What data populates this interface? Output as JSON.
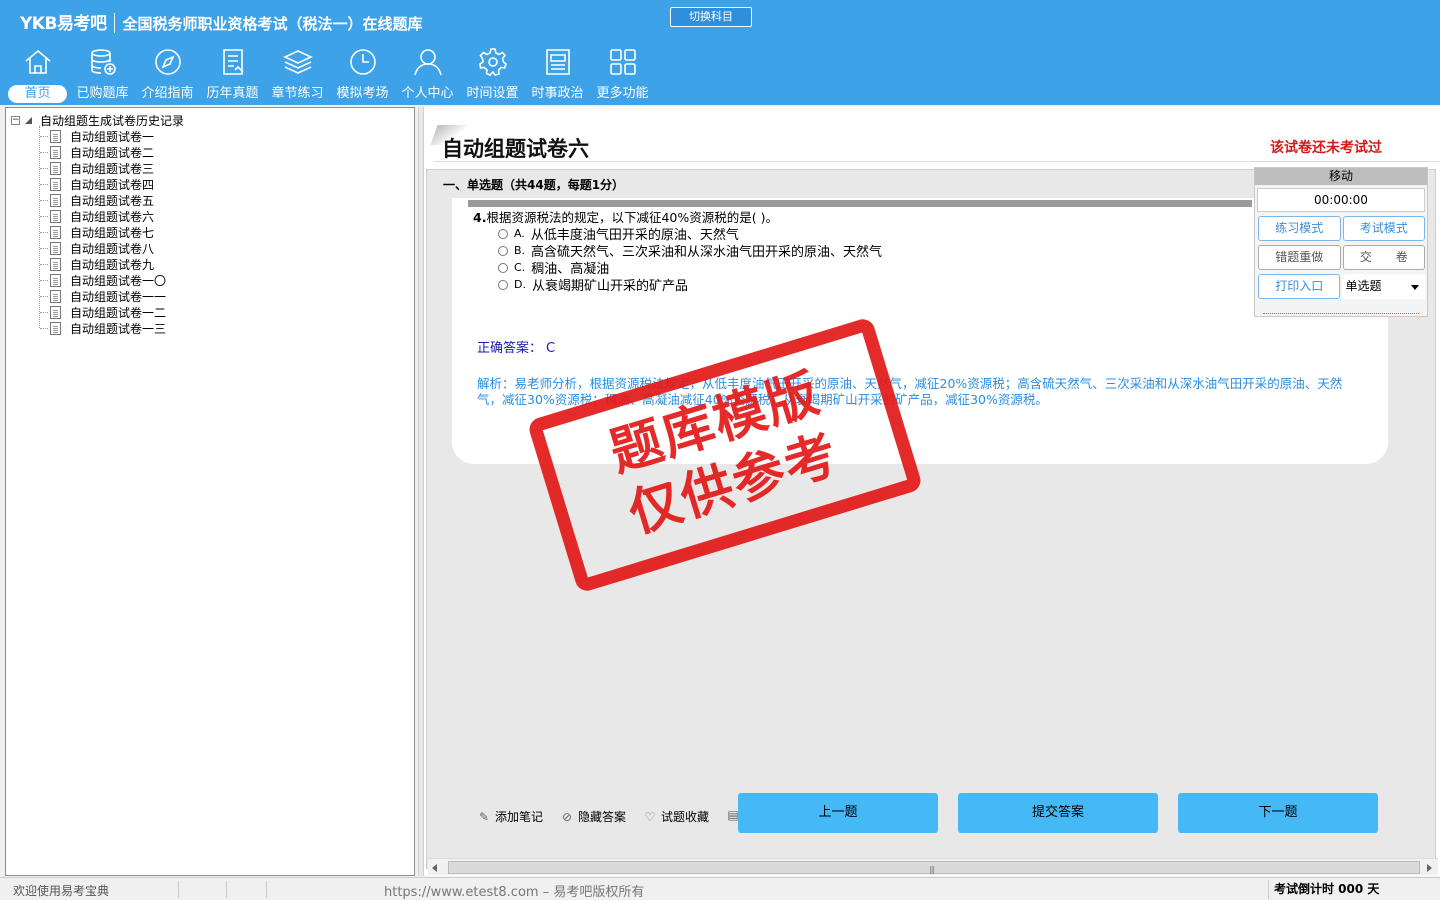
{
  "header": {
    "brand": "YKB易考吧",
    "title": "全国税务师职业资格考试（税法一）在线题库",
    "switch_subject": "切换科目"
  },
  "nav": [
    {
      "label": "首页",
      "icon": "home-icon",
      "active": true
    },
    {
      "label": "已购题库",
      "icon": "database-icon"
    },
    {
      "label": "介绍指南",
      "icon": "compass-icon"
    },
    {
      "label": "历年真题",
      "icon": "document-list-icon"
    },
    {
      "label": "章节练习",
      "icon": "layers-icon"
    },
    {
      "label": "模拟考场",
      "icon": "clock-icon"
    },
    {
      "label": "个人中心",
      "icon": "user-icon"
    },
    {
      "label": "时间设置",
      "icon": "gear-icon"
    },
    {
      "label": "时事政治",
      "icon": "news-icon"
    },
    {
      "label": "更多功能",
      "icon": "grid-icon"
    }
  ],
  "tree": {
    "root": "自动组题生成试卷历史记录",
    "items": [
      "自动组题试卷一",
      "自动组题试卷二",
      "自动组题试卷三",
      "自动组题试卷四",
      "自动组题试卷五",
      "自动组题试卷六",
      "自动组题试卷七",
      "自动组题试卷八",
      "自动组题试卷九",
      "自动组题试卷一〇",
      "自动组题试卷一一",
      "自动组题试卷一二",
      "自动组题试卷一三"
    ]
  },
  "paper": {
    "title": "自动组题试卷六",
    "status": "该试卷还未考试过",
    "section": "一、单选题（共44题，每题1分）"
  },
  "question": {
    "number": "4.",
    "text": "根据资源税法的规定，以下减征40%资源税的是( )。",
    "options": [
      {
        "letter": "A.",
        "text": "从低丰度油气田开采的原油、天然气"
      },
      {
        "letter": "B.",
        "text": "高含硫天然气、三次采油和从深水油气田开采的原油、天然气"
      },
      {
        "letter": "C.",
        "text": "稠油、高凝油"
      },
      {
        "letter": "D.",
        "text": "从衰竭期矿山开采的矿产品"
      }
    ],
    "answer_label": "正确答案：",
    "answer_value": "C",
    "analysis": "解析：易老师分析，根据资源税法规定，从低丰度油气田开采的原油、天然气，减征20%资源税；高含硫天然气、三次采油和从深水油气田开采的原油、天然气，减征30%资源税；稠油、高凝油减征40%资源税；从衰竭期矿山开采的矿产品，减征30%资源税。"
  },
  "stamp": {
    "line1": "题库模版",
    "line2": "仅供参考"
  },
  "control": {
    "move": "移动",
    "timer": "00:00:00",
    "practice_mode": "练习模式",
    "exam_mode": "考试模式",
    "redo_wrong": "错题重做",
    "submit_paper": "交　　卷",
    "print": "打印入口",
    "type_select": "单选题"
  },
  "tools": {
    "add_note": "添加笔记",
    "hide_answer": "隐藏答案",
    "favorite": "试题收藏"
  },
  "buttons": {
    "prev": "上一题",
    "submit": "提交答案",
    "next": "下一题"
  },
  "status": {
    "welcome": "欢迎使用易考宝典",
    "site": "https://www.etest8.com – 易考吧版权所有",
    "countdown": "考试倒计时 000 天"
  }
}
